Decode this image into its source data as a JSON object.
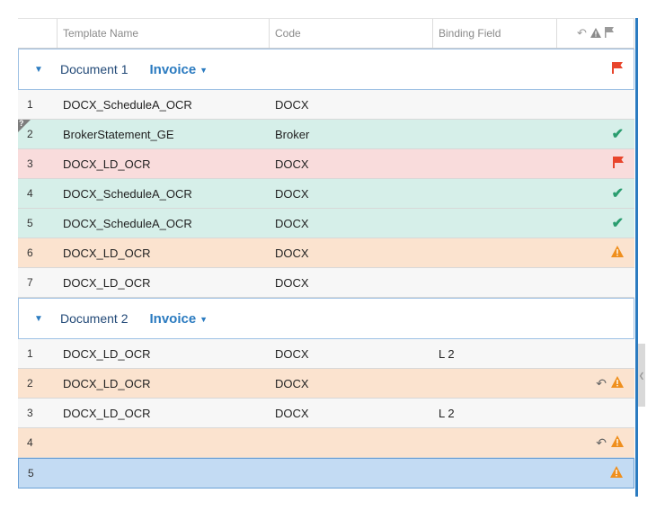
{
  "header": {
    "num": "",
    "template_name": "Template Name",
    "code": "Code",
    "binding_field": "Binding Field",
    "icons": [
      "reply-icon",
      "warning-icon",
      "flag-icon"
    ]
  },
  "groups": [
    {
      "title": "Document 1",
      "type": "Invoice",
      "status": "error",
      "rows": [
        {
          "num": "1",
          "name": "DOCX_ScheduleA_OCR",
          "code": "DOCX",
          "binding": "",
          "status": "none"
        },
        {
          "num": "2",
          "name": "BrokerStatement_GE",
          "code": "Broker",
          "binding": "",
          "status": "ok",
          "corner": "?"
        },
        {
          "num": "3",
          "name": "DOCX_LD_OCR",
          "code": "DOCX",
          "binding": "",
          "status": "error"
        },
        {
          "num": "4",
          "name": "DOCX_ScheduleA_OCR",
          "code": "DOCX",
          "binding": "",
          "status": "ok"
        },
        {
          "num": "5",
          "name": "DOCX_ScheduleA_OCR",
          "code": "DOCX",
          "binding": "",
          "status": "ok"
        },
        {
          "num": "6",
          "name": "DOCX_LD_OCR",
          "code": "DOCX",
          "binding": "",
          "status": "warn"
        },
        {
          "num": "7",
          "name": "DOCX_LD_OCR",
          "code": "DOCX",
          "binding": "",
          "status": "none"
        }
      ]
    },
    {
      "title": "Document 2",
      "type": "Invoice",
      "status": "none",
      "rows": [
        {
          "num": "1",
          "name": "DOCX_LD_OCR",
          "code": "DOCX",
          "binding": "L 2",
          "status": "none"
        },
        {
          "num": "2",
          "name": "DOCX_LD_OCR",
          "code": "DOCX",
          "binding": "",
          "status": "warn",
          "reply": true
        },
        {
          "num": "3",
          "name": "DOCX_LD_OCR",
          "code": "DOCX",
          "binding": "L 2",
          "status": "none"
        },
        {
          "num": "4",
          "name": "",
          "code": "",
          "binding": "",
          "status": "warn",
          "reply": true
        },
        {
          "num": "5",
          "name": "",
          "code": "",
          "binding": "",
          "status": "warn",
          "selected": true
        }
      ]
    }
  ],
  "colors": {
    "accent": "#2b7bc0",
    "ok": "#2a9d6f",
    "error": "#e8452c",
    "warn": "#ef8f1e"
  }
}
